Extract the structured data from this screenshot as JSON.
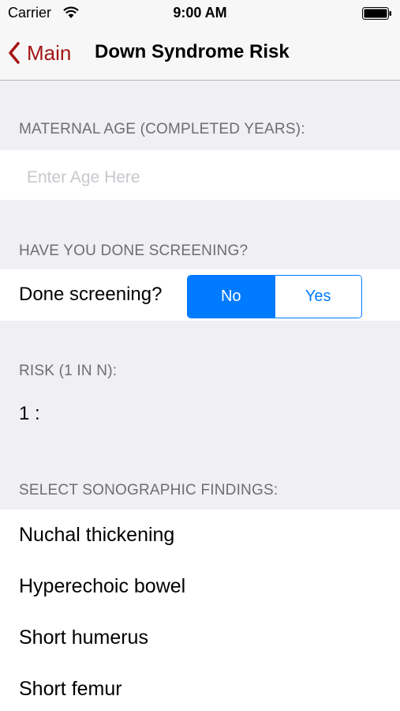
{
  "status_bar": {
    "carrier": "Carrier",
    "time": "9:00 AM"
  },
  "nav": {
    "back_label": "Main",
    "title": "Down Syndrome Risk",
    "accent_color": "#a51515"
  },
  "age_section": {
    "header": "MATERNAL AGE (COMPLETED YEARS):",
    "placeholder": "Enter Age Here",
    "value": ""
  },
  "screening_section": {
    "header": "HAVE YOU DONE SCREENING?",
    "label": "Done screening?",
    "options": [
      "No",
      "Yes"
    ],
    "selected": "No",
    "tint_color": "#007aff"
  },
  "risk_section": {
    "header": "RISK (1 IN N):",
    "value": "1 :"
  },
  "findings_section": {
    "header": "SELECT SONOGRAPHIC FINDINGS:",
    "items": [
      "Nuchal thickening",
      "Hyperechoic bowel",
      "Short humerus",
      "Short femur"
    ]
  }
}
